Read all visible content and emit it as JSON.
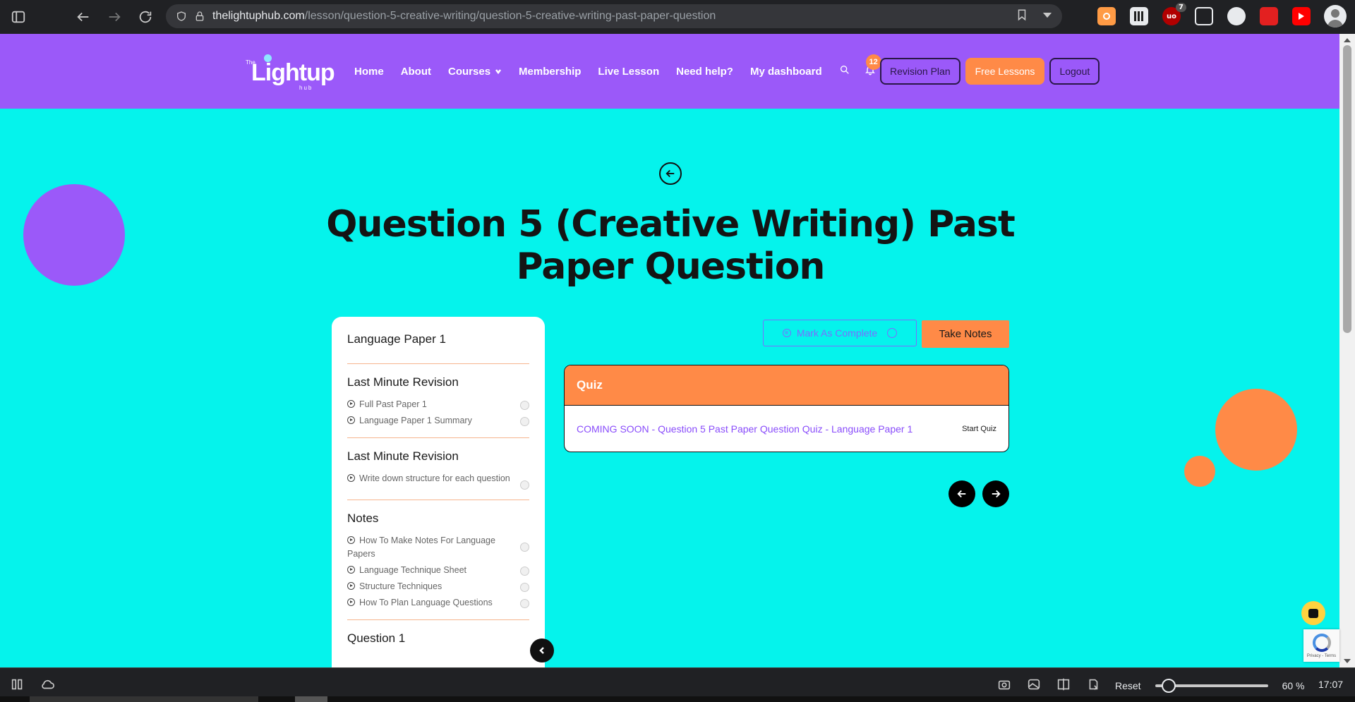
{
  "browser": {
    "url_host": "thelightuphub.com",
    "url_path": "/lesson/question-5-creative-writing/question-5-creative-writing-past-paper-question",
    "extensions": [
      {
        "name": "orange-extension-icon",
        "color": "#ff9b45"
      },
      {
        "name": "qr-extension-icon",
        "color": "#e8eaed"
      },
      {
        "name": "ublock-extension-icon",
        "color": "#b10000",
        "badge": "7"
      },
      {
        "name": "glasses-extension-icon",
        "color": "#e8eaed"
      },
      {
        "name": "owl-extension-icon",
        "color": "#e8eaed"
      },
      {
        "name": "red-play-extension-icon",
        "color": "#e32020"
      },
      {
        "name": "youtube-extension-icon",
        "color": "#ff0000"
      }
    ]
  },
  "header": {
    "logo_the": "The",
    "logo_main": "Lightup",
    "logo_hub": "hub",
    "nav": [
      "Home",
      "About",
      "Courses",
      "Membership",
      "Live Lesson",
      "Need help?",
      "My dashboard"
    ],
    "notification_count": "12",
    "buttons": {
      "revision_plan": "Revision Plan",
      "free_lessons": "Free Lessons",
      "logout": "Logout"
    }
  },
  "page": {
    "title": "Question 5 (Creative Writing) Past Paper Question"
  },
  "sidebar": {
    "sections": [
      {
        "heading": "Language Paper 1",
        "lessons": []
      },
      {
        "heading": "Last Minute Revision",
        "lessons": [
          "Full Past Paper 1",
          "Language Paper 1 Summary"
        ]
      },
      {
        "heading": "Last Minute Revision",
        "lessons": [
          "Write down structure for each question"
        ]
      },
      {
        "heading": "Notes",
        "lessons": [
          "How To Make Notes For Language Papers",
          "Language Technique Sheet",
          "Structure Techniques",
          "How To Plan Language Questions"
        ]
      },
      {
        "heading": "Question 1",
        "lessons": []
      }
    ]
  },
  "content": {
    "mark_complete": "Mark As Complete",
    "take_notes": "Take Notes",
    "quiz_header": "Quiz",
    "quiz_title": "COMING SOON - Question 5 Past Paper Question Quiz - Language Paper 1",
    "start_quiz": "Start Quiz"
  },
  "recaptcha": {
    "text": "Privacy - Terms"
  },
  "status_bar": {
    "reset": "Reset",
    "zoom": "60 %",
    "zoom_fraction": 0.12,
    "time": "17:07"
  },
  "colors": {
    "page_bg": "#05f3ec",
    "brand_purple": "#9b59f9",
    "accent_orange": "#ff8a47",
    "link_purple": "#8a4dfb"
  }
}
